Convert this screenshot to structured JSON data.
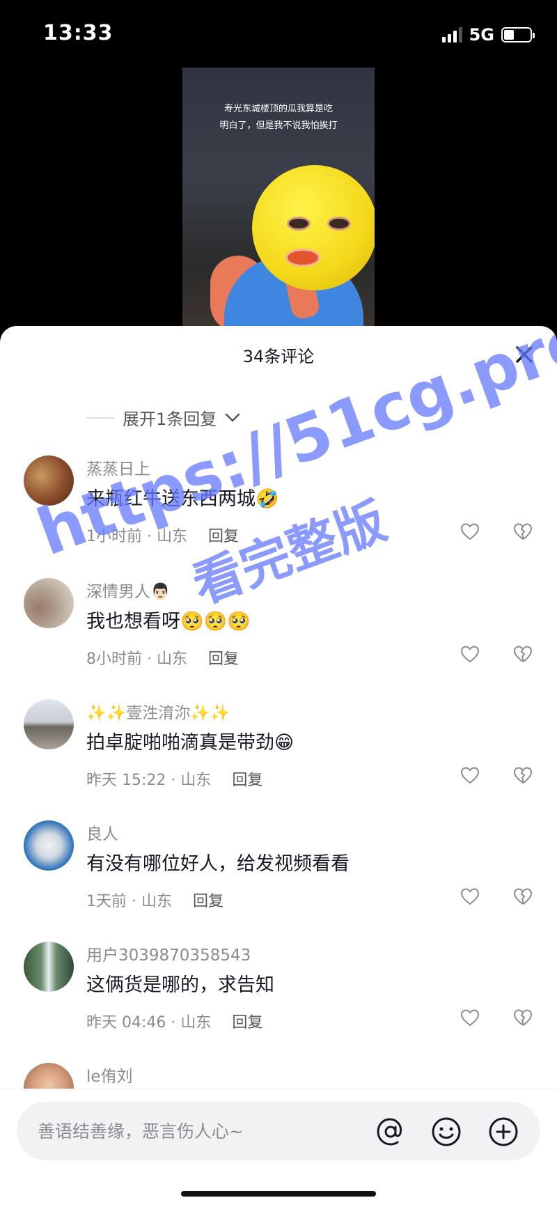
{
  "status_bar": {
    "time": "13:33",
    "network": "5G"
  },
  "video": {
    "caption_line1": "寿光东城楼顶的瓜我算是吃",
    "caption_line2": "明白了，但是我不说我怕挨打"
  },
  "sheet": {
    "title": "34条评论",
    "expand_replies": "展开1条回复"
  },
  "comments": [
    {
      "name": "蒸蒸日上",
      "text": "来瓶红牛送东西两城🤣",
      "time": "1小时前 · 山东",
      "reply": "回复"
    },
    {
      "name": "深情男人👨🏻",
      "text": "我也想看呀🥺🥺🥺",
      "time": "8小时前 · 山东",
      "reply": "回复"
    },
    {
      "name": "✨✨壹泩淯沵✨✨",
      "text": "拍卓腚啪啪滴真是带劲😁",
      "time": "昨天 15:22 · 山东",
      "reply": "回复"
    },
    {
      "name": "良人",
      "text": "有没有哪位好人，给发视频看看",
      "time": "1天前 · 山东",
      "reply": "回复"
    },
    {
      "name": "用户3039870358543",
      "text": "这俩货是哪的，求告知",
      "time": "昨天 04:46 · 山东",
      "reply": "回复"
    },
    {
      "name": "le侑刘",
      "text": "",
      "time": "",
      "reply": ""
    }
  ],
  "input": {
    "placeholder": "善语结善缘，恶言伤人心~"
  },
  "watermark": {
    "line1": "https://51cg.pro/",
    "line2": "看完整版"
  },
  "colors": {
    "watermark": "#6478ff",
    "text_primary": "#161823",
    "text_secondary": "#8a8b91"
  }
}
